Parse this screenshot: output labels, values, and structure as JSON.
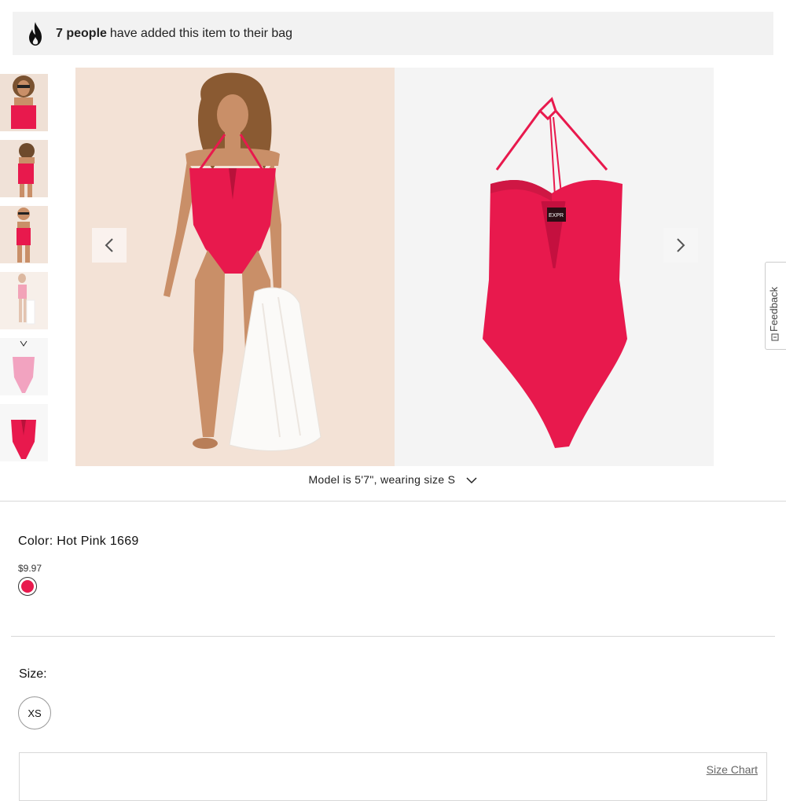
{
  "banner": {
    "count_text": "7 people",
    "message": "have added this item to their bag"
  },
  "model_info": "Model is 5'7\", wearing size S",
  "color": {
    "label": "Color: Hot Pink 1669",
    "price": "$9.97",
    "swatch_hex": "#e8194d"
  },
  "size": {
    "label": "Size:",
    "options": [
      "XS"
    ]
  },
  "size_chart": "Size Chart",
  "feedback": "Feedback",
  "colors": {
    "accent_pink": "#e8194d",
    "banner_bg": "#f2f2f2"
  }
}
